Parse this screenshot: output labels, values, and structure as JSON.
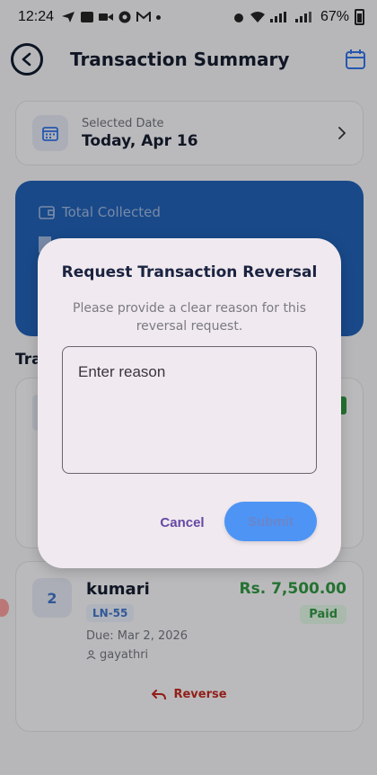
{
  "status_bar": {
    "time": "12:24",
    "battery": "67%",
    "indicators": [
      "navigation-icon",
      "mail-icon",
      "video-icon",
      "chrome-icon",
      "gmail-icon",
      "dot"
    ]
  },
  "app_bar": {
    "title": "Transaction Summary",
    "back_icon": "back-circle-icon",
    "calendar_icon": "calendar-icon"
  },
  "date_card": {
    "label": "Selected Date",
    "value": "Today, Apr 16"
  },
  "total_card": {
    "label": "Total Collected"
  },
  "section_label": "Tra",
  "transaction_2": {
    "number": "2",
    "name": "kumari",
    "loan_id": "LN-55",
    "amount": "Rs. 7,500.00",
    "status": "Paid",
    "due": "Due: Mar 2, 2026",
    "user": "gayathri",
    "reverse_label": "Reverse"
  },
  "dialog": {
    "title": "Request Transaction Reversal",
    "body": "Please provide a clear reason for this reversal request.",
    "reason_placeholder": "Enter reason",
    "reason_value": "",
    "cancel_label": "Cancel",
    "submit_label": "Submit"
  },
  "colors": {
    "accent_blue": "#1f5aa8",
    "submit_blue": "#4d94f5",
    "paid_green": "#2e8b3e",
    "reverse_red": "#b3261e",
    "cancel_purple": "#6548a3"
  }
}
